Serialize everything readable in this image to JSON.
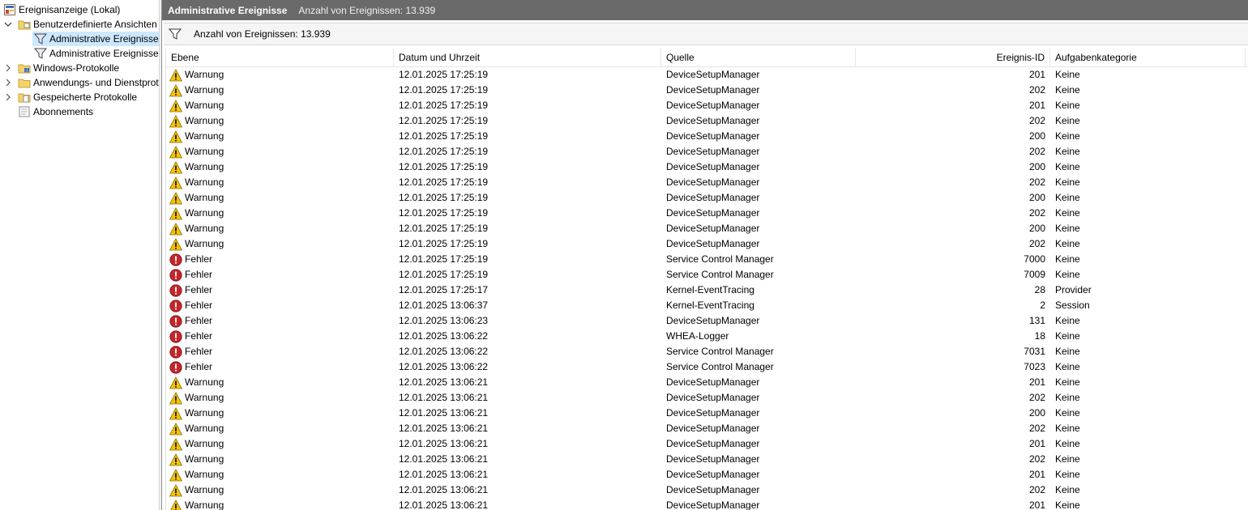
{
  "tree": {
    "root_label": "Ereignisanzeige (Lokal)",
    "custom_views_label": "Benutzerdefinierte Ansichten",
    "admin_events_1": "Administrative Ereignisse",
    "admin_events_2": "Administrative Ereignisse",
    "windows_logs": "Windows-Protokolle",
    "app_service_logs": "Anwendungs- und Dienstprotokolle",
    "saved_logs": "Gespeicherte Protokolle",
    "subscriptions": "Abonnements"
  },
  "header": {
    "title": "Administrative Ereignisse",
    "count_text": "Anzahl von Ereignissen: 13.939"
  },
  "infobar": {
    "count_text": "Anzahl von Ereignissen: 13.939"
  },
  "columns": {
    "level": "Ebene",
    "date": "Datum und Uhrzeit",
    "source": "Quelle",
    "id": "Ereignis-ID",
    "category": "Aufgabenkategorie"
  },
  "rows": [
    {
      "level": "Warnung",
      "type": "warning",
      "date": "12.01.2025 17:25:19",
      "source": "DeviceSetupManager",
      "id": "201",
      "category": "Keine"
    },
    {
      "level": "Warnung",
      "type": "warning",
      "date": "12.01.2025 17:25:19",
      "source": "DeviceSetupManager",
      "id": "202",
      "category": "Keine"
    },
    {
      "level": "Warnung",
      "type": "warning",
      "date": "12.01.2025 17:25:19",
      "source": "DeviceSetupManager",
      "id": "201",
      "category": "Keine"
    },
    {
      "level": "Warnung",
      "type": "warning",
      "date": "12.01.2025 17:25:19",
      "source": "DeviceSetupManager",
      "id": "202",
      "category": "Keine"
    },
    {
      "level": "Warnung",
      "type": "warning",
      "date": "12.01.2025 17:25:19",
      "source": "DeviceSetupManager",
      "id": "200",
      "category": "Keine"
    },
    {
      "level": "Warnung",
      "type": "warning",
      "date": "12.01.2025 17:25:19",
      "source": "DeviceSetupManager",
      "id": "202",
      "category": "Keine"
    },
    {
      "level": "Warnung",
      "type": "warning",
      "date": "12.01.2025 17:25:19",
      "source": "DeviceSetupManager",
      "id": "200",
      "category": "Keine"
    },
    {
      "level": "Warnung",
      "type": "warning",
      "date": "12.01.2025 17:25:19",
      "source": "DeviceSetupManager",
      "id": "202",
      "category": "Keine"
    },
    {
      "level": "Warnung",
      "type": "warning",
      "date": "12.01.2025 17:25:19",
      "source": "DeviceSetupManager",
      "id": "200",
      "category": "Keine"
    },
    {
      "level": "Warnung",
      "type": "warning",
      "date": "12.01.2025 17:25:19",
      "source": "DeviceSetupManager",
      "id": "202",
      "category": "Keine"
    },
    {
      "level": "Warnung",
      "type": "warning",
      "date": "12.01.2025 17:25:19",
      "source": "DeviceSetupManager",
      "id": "200",
      "category": "Keine"
    },
    {
      "level": "Warnung",
      "type": "warning",
      "date": "12.01.2025 17:25:19",
      "source": "DeviceSetupManager",
      "id": "202",
      "category": "Keine"
    },
    {
      "level": "Fehler",
      "type": "error",
      "date": "12.01.2025 17:25:19",
      "source": "Service Control Manager",
      "id": "7000",
      "category": "Keine"
    },
    {
      "level": "Fehler",
      "type": "error",
      "date": "12.01.2025 17:25:19",
      "source": "Service Control Manager",
      "id": "7009",
      "category": "Keine"
    },
    {
      "level": "Fehler",
      "type": "error",
      "date": "12.01.2025 17:25:17",
      "source": "Kernel-EventTracing",
      "id": "28",
      "category": "Provider"
    },
    {
      "level": "Fehler",
      "type": "error",
      "date": "12.01.2025 13:06:37",
      "source": "Kernel-EventTracing",
      "id": "2",
      "category": "Session"
    },
    {
      "level": "Fehler",
      "type": "error",
      "date": "12.01.2025 13:06:23",
      "source": "DeviceSetupManager",
      "id": "131",
      "category": "Keine"
    },
    {
      "level": "Fehler",
      "type": "error",
      "date": "12.01.2025 13:06:22",
      "source": "WHEA-Logger",
      "id": "18",
      "category": "Keine"
    },
    {
      "level": "Fehler",
      "type": "error",
      "date": "12.01.2025 13:06:22",
      "source": "Service Control Manager",
      "id": "7031",
      "category": "Keine"
    },
    {
      "level": "Fehler",
      "type": "error",
      "date": "12.01.2025 13:06:22",
      "source": "Service Control Manager",
      "id": "7023",
      "category": "Keine"
    },
    {
      "level": "Warnung",
      "type": "warning",
      "date": "12.01.2025 13:06:21",
      "source": "DeviceSetupManager",
      "id": "201",
      "category": "Keine"
    },
    {
      "level": "Warnung",
      "type": "warning",
      "date": "12.01.2025 13:06:21",
      "source": "DeviceSetupManager",
      "id": "202",
      "category": "Keine"
    },
    {
      "level": "Warnung",
      "type": "warning",
      "date": "12.01.2025 13:06:21",
      "source": "DeviceSetupManager",
      "id": "200",
      "category": "Keine"
    },
    {
      "level": "Warnung",
      "type": "warning",
      "date": "12.01.2025 13:06:21",
      "source": "DeviceSetupManager",
      "id": "202",
      "category": "Keine"
    },
    {
      "level": "Warnung",
      "type": "warning",
      "date": "12.01.2025 13:06:21",
      "source": "DeviceSetupManager",
      "id": "201",
      "category": "Keine"
    },
    {
      "level": "Warnung",
      "type": "warning",
      "date": "12.01.2025 13:06:21",
      "source": "DeviceSetupManager",
      "id": "202",
      "category": "Keine"
    },
    {
      "level": "Warnung",
      "type": "warning",
      "date": "12.01.2025 13:06:21",
      "source": "DeviceSetupManager",
      "id": "201",
      "category": "Keine"
    },
    {
      "level": "Warnung",
      "type": "warning",
      "date": "12.01.2025 13:06:21",
      "source": "DeviceSetupManager",
      "id": "202",
      "category": "Keine"
    },
    {
      "level": "Warnung",
      "type": "warning",
      "date": "12.01.2025 13:06:21",
      "source": "DeviceSetupManager",
      "id": "201",
      "category": "Keine"
    }
  ],
  "colors": {
    "titlebar": "#6a6a6a",
    "selection": "#cce8ff",
    "warning": "#f5c400",
    "error": "#c4262e"
  }
}
